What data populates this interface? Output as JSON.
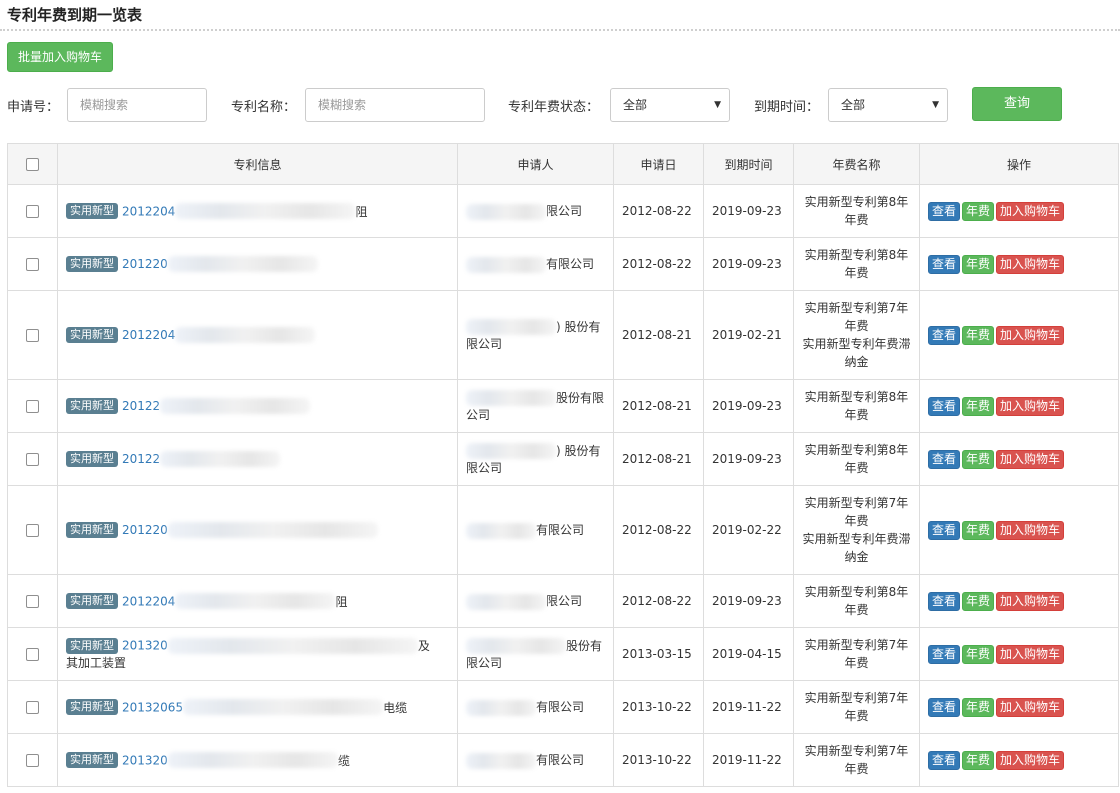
{
  "page_title": "专利年费到期一览表",
  "toolbar": {
    "batch_label": "批量加入购物车"
  },
  "filters": {
    "app_no_label": "申请号：",
    "app_no_placeholder": "模糊搜索",
    "name_label": "专利名称：",
    "name_placeholder": "模糊搜索",
    "status_label": "专利年费状态：",
    "status_value": "全部",
    "due_label": "到期时间：",
    "due_value": "全部",
    "query_label": "查询"
  },
  "icons": {
    "caret": "caret-down-icon"
  },
  "colors": {
    "accent_green": "#5cb85c",
    "primary_blue": "#337ab7",
    "danger_red": "#d9534f",
    "badge_gray": "#5a7f91",
    "overdue_text": "#a94442"
  },
  "table": {
    "headers": [
      "专利信息",
      "申请人",
      "申请日",
      "到期时间",
      "年费名称",
      "操作"
    ],
    "action_labels": {
      "view": "查看",
      "fee": "年费",
      "cart": "加入购物车"
    },
    "rows": [
      {
        "type": "实用新型",
        "app_no": "2012204",
        "name_tail": "阻",
        "applicant_pre": "",
        "applicant_tail": "限公司",
        "app_date": "2012-08-22",
        "due_date": "2019-09-23",
        "fee_lines": [
          "实用新型专利第8年",
          "年费"
        ],
        "overdue": false
      },
      {
        "type": "实用新型",
        "app_no": "201220",
        "name_tail": "",
        "applicant_pre": "",
        "applicant_tail": "有限公司",
        "app_date": "2012-08-22",
        "due_date": "2019-09-23",
        "fee_lines": [
          "实用新型专利第8年",
          "年费"
        ],
        "overdue": false
      },
      {
        "type": "实用新型",
        "app_no": "2012204",
        "name_tail": "",
        "applicant_pre": "",
        "applicant_tail": ") 股份有限公司",
        "app_date": "2012-08-21",
        "due_date": "2019-02-21",
        "fee_lines": [
          "实用新型专利第7年",
          "年费",
          "实用新型专利年费滞",
          "纳金"
        ],
        "overdue": true
      },
      {
        "type": "实用新型",
        "app_no": "20122",
        "name_tail": "",
        "applicant_pre": "",
        "applicant_tail": "股份有限公司",
        "app_date": "2012-08-21",
        "due_date": "2019-09-23",
        "fee_lines": [
          "实用新型专利第8年",
          "年费"
        ],
        "overdue": false
      },
      {
        "type": "实用新型",
        "app_no": "20122",
        "name_tail": "",
        "applicant_pre": "",
        "applicant_tail": ") 股份有限公司",
        "app_date": "2012-08-21",
        "due_date": "2019-09-23",
        "fee_lines": [
          "实用新型专利第8年",
          "年费"
        ],
        "overdue": false
      },
      {
        "type": "实用新型",
        "app_no": "201220",
        "name_tail": "",
        "applicant_pre": "",
        "applicant_tail": "有限公司",
        "app_date": "2012-08-22",
        "due_date": "2019-02-22",
        "fee_lines": [
          "实用新型专利第7年",
          "年费",
          "实用新型专利年费滞",
          "纳金"
        ],
        "overdue": true
      },
      {
        "type": "实用新型",
        "app_no": "2012204",
        "name_tail": "阻",
        "applicant_pre": "",
        "applicant_tail": "限公司",
        "app_date": "2012-08-22",
        "due_date": "2019-09-23",
        "fee_lines": [
          "实用新型专利第8年",
          "年费"
        ],
        "overdue": false
      },
      {
        "type": "实用新型",
        "app_no": "201320",
        "name_tail": "及",
        "name_line2": "其加工装置",
        "applicant_pre": "",
        "applicant_tail": "股份有限公司",
        "app_date": "2013-03-15",
        "due_date": "2019-04-15",
        "fee_lines": [
          "实用新型专利第7年",
          "年费"
        ],
        "overdue": false
      },
      {
        "type": "实用新型",
        "app_no": "20132065",
        "name_tail": "电缆",
        "applicant_pre": "",
        "applicant_tail": "有限公司",
        "app_date": "2013-10-22",
        "due_date": "2019-11-22",
        "fee_lines": [
          "实用新型专利第7年",
          "年费"
        ],
        "overdue": false
      },
      {
        "type": "实用新型",
        "app_no": "201320",
        "name_tail": "缆",
        "applicant_pre": "",
        "applicant_tail": "有限公司",
        "app_date": "2013-10-22",
        "due_date": "2019-11-22",
        "fee_lines": [
          "实用新型专利第7年",
          "年费"
        ],
        "overdue": false
      }
    ]
  }
}
